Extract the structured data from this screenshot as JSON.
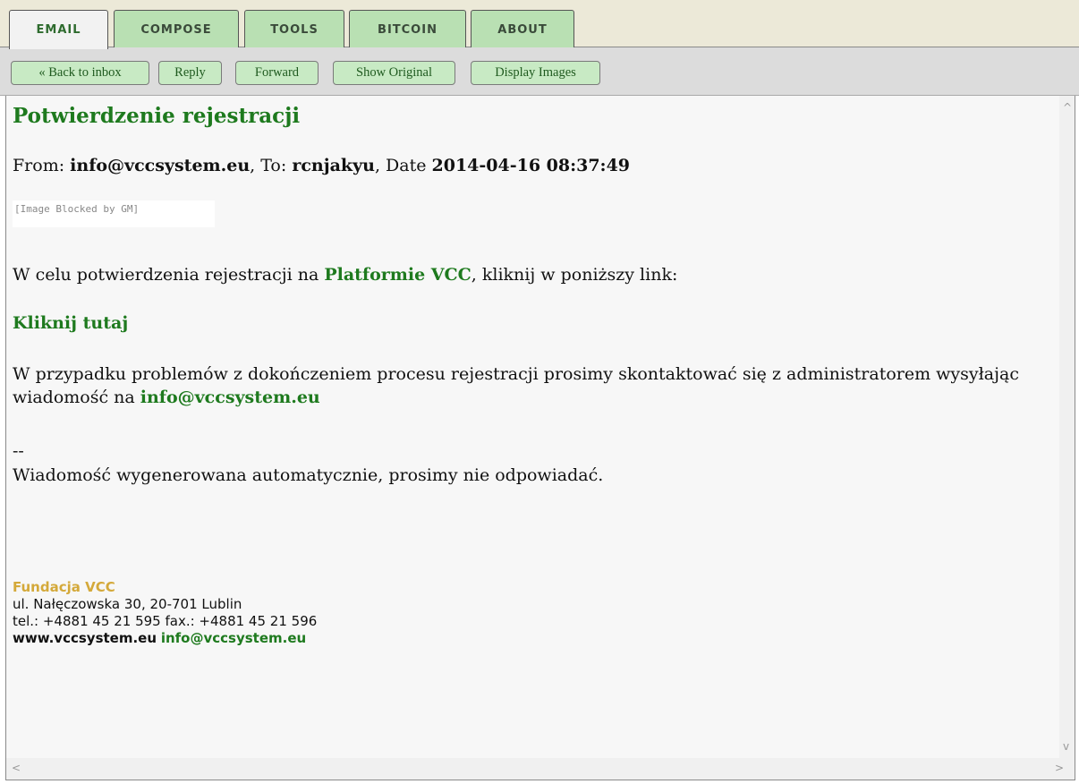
{
  "tabs": [
    {
      "label": "EMAIL"
    },
    {
      "label": "COMPOSE"
    },
    {
      "label": "TOOLS"
    },
    {
      "label": "BITCOIN"
    },
    {
      "label": "ABOUT"
    }
  ],
  "toolbar": {
    "back": "« Back to inbox",
    "reply": "Reply",
    "forward": "Forward",
    "show_original": "Show Original",
    "display_images": "Display Images"
  },
  "email": {
    "subject": "Potwierdzenie rejestracji",
    "from_label": "From:",
    "from": "info@vccsystem.eu",
    "to_label": ", To:",
    "to": "rcnjakyu",
    "date_label": ", Date",
    "date": "2014-04-16 08:37:49",
    "blocked_image": "[Image Blocked by GM]",
    "p1_before": "W celu potwierdzenia rejestracji na ",
    "p1_link": "Platformie VCC",
    "p1_after": ", kliknij w poniższy link:",
    "click_link": "Kliknij tutaj",
    "p2_text": "W przypadku problemów z dokończeniem procesu rejestracji prosimy skontaktować się z administratorem wysyłając wiadomość na ",
    "p2_link": "info@vccsystem.eu",
    "separator": "--",
    "auto_note": "Wiadomość wygenerowana automatycznie, prosimy nie odpowiadać.",
    "signature": {
      "org": "Fundacja VCC",
      "address": "ul. Nałęczowska 30, 20-701 Lublin",
      "phone": "tel.: +4881 45 21 595 fax.: +4881 45 21 596",
      "web": "www.vccsystem.eu",
      "email": "info@vccsystem.eu"
    }
  },
  "scroll": {
    "up_icon": "^",
    "down_icon": "v",
    "left_icon": "<",
    "right_icon": ">"
  },
  "colors": {
    "accent": "#1e7a1e",
    "tab_bg": "#b9e0b3",
    "org": "#d4a93a"
  }
}
